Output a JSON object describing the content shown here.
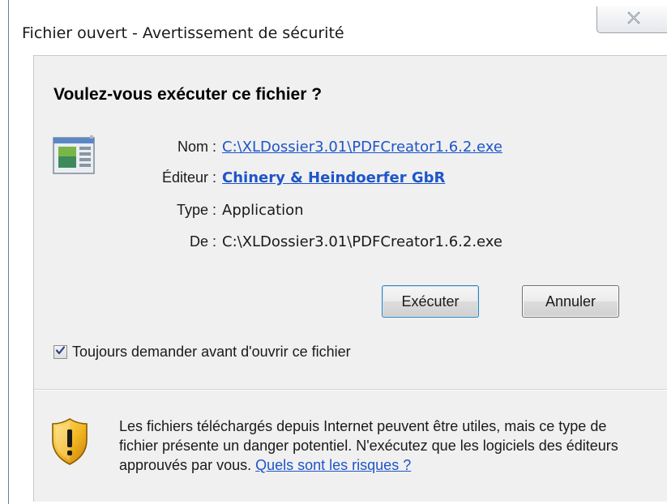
{
  "window": {
    "title": "Fichier ouvert - Avertissement de sécurité",
    "close_icon": "close-icon"
  },
  "dialog": {
    "question": "Voulez-vous exécuter ce fichier ?",
    "file_icon": "application-icon",
    "fields": {
      "name_label": "Nom :",
      "name_value": "C:\\XLDossier3.01\\PDFCreator1.6.2.exe",
      "publisher_label": "Éditeur :",
      "publisher_value": "Chinery & Heindoerfer GbR",
      "type_label": "Type :",
      "type_value": "Application",
      "from_label": "De :",
      "from_value": "C:\\XLDossier3.01\\PDFCreator1.6.2.exe"
    },
    "buttons": {
      "run_label": "Exécuter",
      "cancel_label": "Annuler"
    },
    "checkbox": {
      "label": "Toujours demander avant d'ouvrir ce fichier",
      "checked": true
    },
    "warning": {
      "icon": "shield-warning-icon",
      "text": "Les fichiers téléchargés depuis Internet peuvent être utiles, mais ce type de fichier présente un danger potentiel. N'exécutez que les logiciels des éditeurs approuvés par vous. ",
      "link_text": "Quels sont les risques ?"
    }
  },
  "colors": {
    "link": "#1e55c8",
    "panel_background": "#f0f0f0",
    "shield_yellow": "#f2b620"
  }
}
